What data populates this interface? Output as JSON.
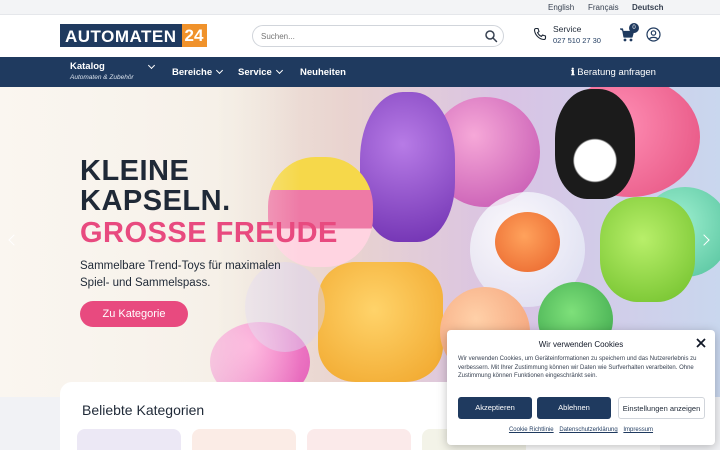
{
  "languages": [
    "English",
    "Français",
    "Deutsch"
  ],
  "header": {
    "logo_main": "AUTOMATEN",
    "logo_num": "24",
    "search_placeholder": "Suchen...",
    "service_title": "Service",
    "service_phone": "027 510 27 30",
    "cart_count": "0"
  },
  "nav": {
    "katalog": "Katalog",
    "katalog_sub": "Automaten & Zubehör",
    "bereiche": "Bereiche",
    "service": "Service",
    "neuheiten": "Neuheiten",
    "beratung": "Beratung anfragen"
  },
  "hero": {
    "line1": "KLEINE",
    "line2": "KAPSELN.",
    "line3": "GROSSE FREUDE",
    "subtitle": "Sammelbare Trend-Toys für maximalen Spiel- und Sammelspass.",
    "button": "Zu Kategorie"
  },
  "categories": {
    "title": "Beliebte Kategorien"
  },
  "cookie": {
    "title": "Wir verwenden Cookies",
    "text": "Wir verwenden Cookies, um Geräteinformationen zu speichern und das Nutzererlebnis zu verbessern. Mit Ihrer Zustimmung können wir Daten wie Surfverhalten verarbeiten. Ohne Zustimmung können Funktionen eingeschränkt sein.",
    "accept": "Akzeptieren",
    "deny": "Ablehnen",
    "settings": "Einstellungen anzeigen",
    "links": [
      "Cookie Richtlinie",
      "Datenschutzerklärung",
      "Impressum"
    ]
  },
  "colors": {
    "brand": "#1f3a5f",
    "accent": "#e84a7f",
    "logo_orange": "#f0922b"
  }
}
